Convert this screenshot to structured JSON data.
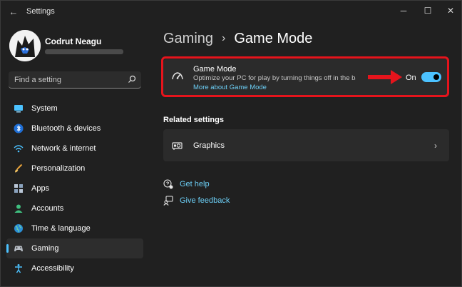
{
  "window": {
    "title": "Settings",
    "back": "←",
    "minimize": "─",
    "maximize": "☐",
    "close": "✕"
  },
  "user": {
    "name": "Codrut Neagu"
  },
  "search": {
    "placeholder": "Find a setting"
  },
  "sidebar": {
    "items": [
      {
        "label": "System",
        "icon": "monitor-icon"
      },
      {
        "label": "Bluetooth & devices",
        "icon": "bluetooth-icon"
      },
      {
        "label": "Network & internet",
        "icon": "wifi-icon"
      },
      {
        "label": "Personalization",
        "icon": "brush-icon"
      },
      {
        "label": "Apps",
        "icon": "apps-icon"
      },
      {
        "label": "Accounts",
        "icon": "person-icon"
      },
      {
        "label": "Time & language",
        "icon": "globe-icon"
      },
      {
        "label": "Gaming",
        "icon": "gamepad-icon",
        "active": true
      },
      {
        "label": "Accessibility",
        "icon": "accessibility-icon"
      }
    ]
  },
  "breadcrumb": {
    "parent": "Gaming",
    "separator": "›",
    "current": "Game Mode"
  },
  "game_mode": {
    "title": "Game Mode",
    "description": "Optimize your PC for play by turning things off in the bac...",
    "link": "More about Game Mode",
    "toggle_label": "On",
    "toggle_on": true
  },
  "related": {
    "title": "Related settings",
    "graphics_label": "Graphics",
    "chevron": "›"
  },
  "help": {
    "get_help": "Get help",
    "give_feedback": "Give feedback"
  },
  "colors": {
    "accent": "#4cc2ff",
    "highlight": "#e5141c",
    "background": "#202020",
    "card": "#2b2b2b"
  }
}
